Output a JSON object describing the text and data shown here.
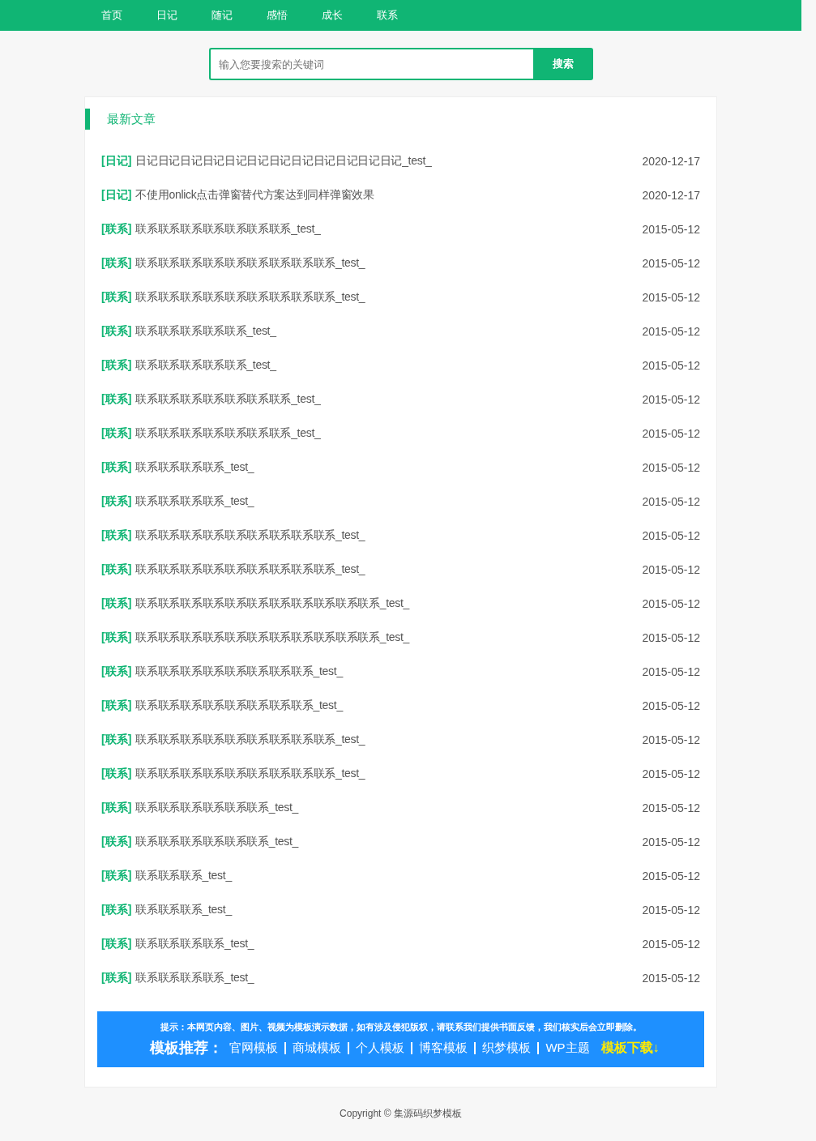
{
  "nav": [
    {
      "label": "首页"
    },
    {
      "label": "日记"
    },
    {
      "label": "随记"
    },
    {
      "label": "感悟"
    },
    {
      "label": "成长"
    },
    {
      "label": "联系"
    }
  ],
  "search": {
    "placeholder": "输入您要搜索的关键词",
    "button": "搜索"
  },
  "section": {
    "title": "最新文章"
  },
  "articles": [
    {
      "category": "[日记]",
      "title": "日记日记日记日记日记日记日记日记日记日记日记日记_test_",
      "date": "2020-12-17"
    },
    {
      "category": "[日记]",
      "title": "不使用onlick点击弹窗替代方案达到同样弹窗效果",
      "date": "2020-12-17"
    },
    {
      "category": "[联系]",
      "title": "联系联系联系联系联系联系联系_test_",
      "date": "2015-05-12"
    },
    {
      "category": "[联系]",
      "title": "联系联系联系联系联系联系联系联系联系_test_",
      "date": "2015-05-12"
    },
    {
      "category": "[联系]",
      "title": "联系联系联系联系联系联系联系联系联系_test_",
      "date": "2015-05-12"
    },
    {
      "category": "[联系]",
      "title": "联系联系联系联系联系_test_",
      "date": "2015-05-12"
    },
    {
      "category": "[联系]",
      "title": "联系联系联系联系联系_test_",
      "date": "2015-05-12"
    },
    {
      "category": "[联系]",
      "title": "联系联系联系联系联系联系联系_test_",
      "date": "2015-05-12"
    },
    {
      "category": "[联系]",
      "title": "联系联系联系联系联系联系联系_test_",
      "date": "2015-05-12"
    },
    {
      "category": "[联系]",
      "title": "联系联系联系联系_test_",
      "date": "2015-05-12"
    },
    {
      "category": "[联系]",
      "title": "联系联系联系联系_test_",
      "date": "2015-05-12"
    },
    {
      "category": "[联系]",
      "title": "联系联系联系联系联系联系联系联系联系_test_",
      "date": "2015-05-12"
    },
    {
      "category": "[联系]",
      "title": "联系联系联系联系联系联系联系联系联系_test_",
      "date": "2015-05-12"
    },
    {
      "category": "[联系]",
      "title": "联系联系联系联系联系联系联系联系联系联系联系_test_",
      "date": "2015-05-12"
    },
    {
      "category": "[联系]",
      "title": "联系联系联系联系联系联系联系联系联系联系联系_test_",
      "date": "2015-05-12"
    },
    {
      "category": "[联系]",
      "title": "联系联系联系联系联系联系联系联系_test_",
      "date": "2015-05-12"
    },
    {
      "category": "[联系]",
      "title": "联系联系联系联系联系联系联系联系_test_",
      "date": "2015-05-12"
    },
    {
      "category": "[联系]",
      "title": "联系联系联系联系联系联系联系联系联系_test_",
      "date": "2015-05-12"
    },
    {
      "category": "[联系]",
      "title": "联系联系联系联系联系联系联系联系联系_test_",
      "date": "2015-05-12"
    },
    {
      "category": "[联系]",
      "title": "联系联系联系联系联系联系_test_",
      "date": "2015-05-12"
    },
    {
      "category": "[联系]",
      "title": "联系联系联系联系联系联系_test_",
      "date": "2015-05-12"
    },
    {
      "category": "[联系]",
      "title": "联系联系联系_test_",
      "date": "2015-05-12"
    },
    {
      "category": "[联系]",
      "title": "联系联系联系_test_",
      "date": "2015-05-12"
    },
    {
      "category": "[联系]",
      "title": "联系联系联系联系_test_",
      "date": "2015-05-12"
    },
    {
      "category": "[联系]",
      "title": "联系联系联系联系_test_",
      "date": "2015-05-12"
    }
  ],
  "notice": {
    "text": "提示：本网页内容、图片、视频为模板演示数据，如有涉及侵犯版权，请联系我们提供书面反馈，我们核实后会立即删除。",
    "label": "模板推荐：",
    "links": [
      "官网模板",
      "商城模板",
      "个人模板",
      "博客模板",
      "织梦模板",
      "WP主题"
    ],
    "download": "模板下载↓"
  },
  "footer": {
    "copyright": "Copyright © 集源码织梦模板"
  }
}
